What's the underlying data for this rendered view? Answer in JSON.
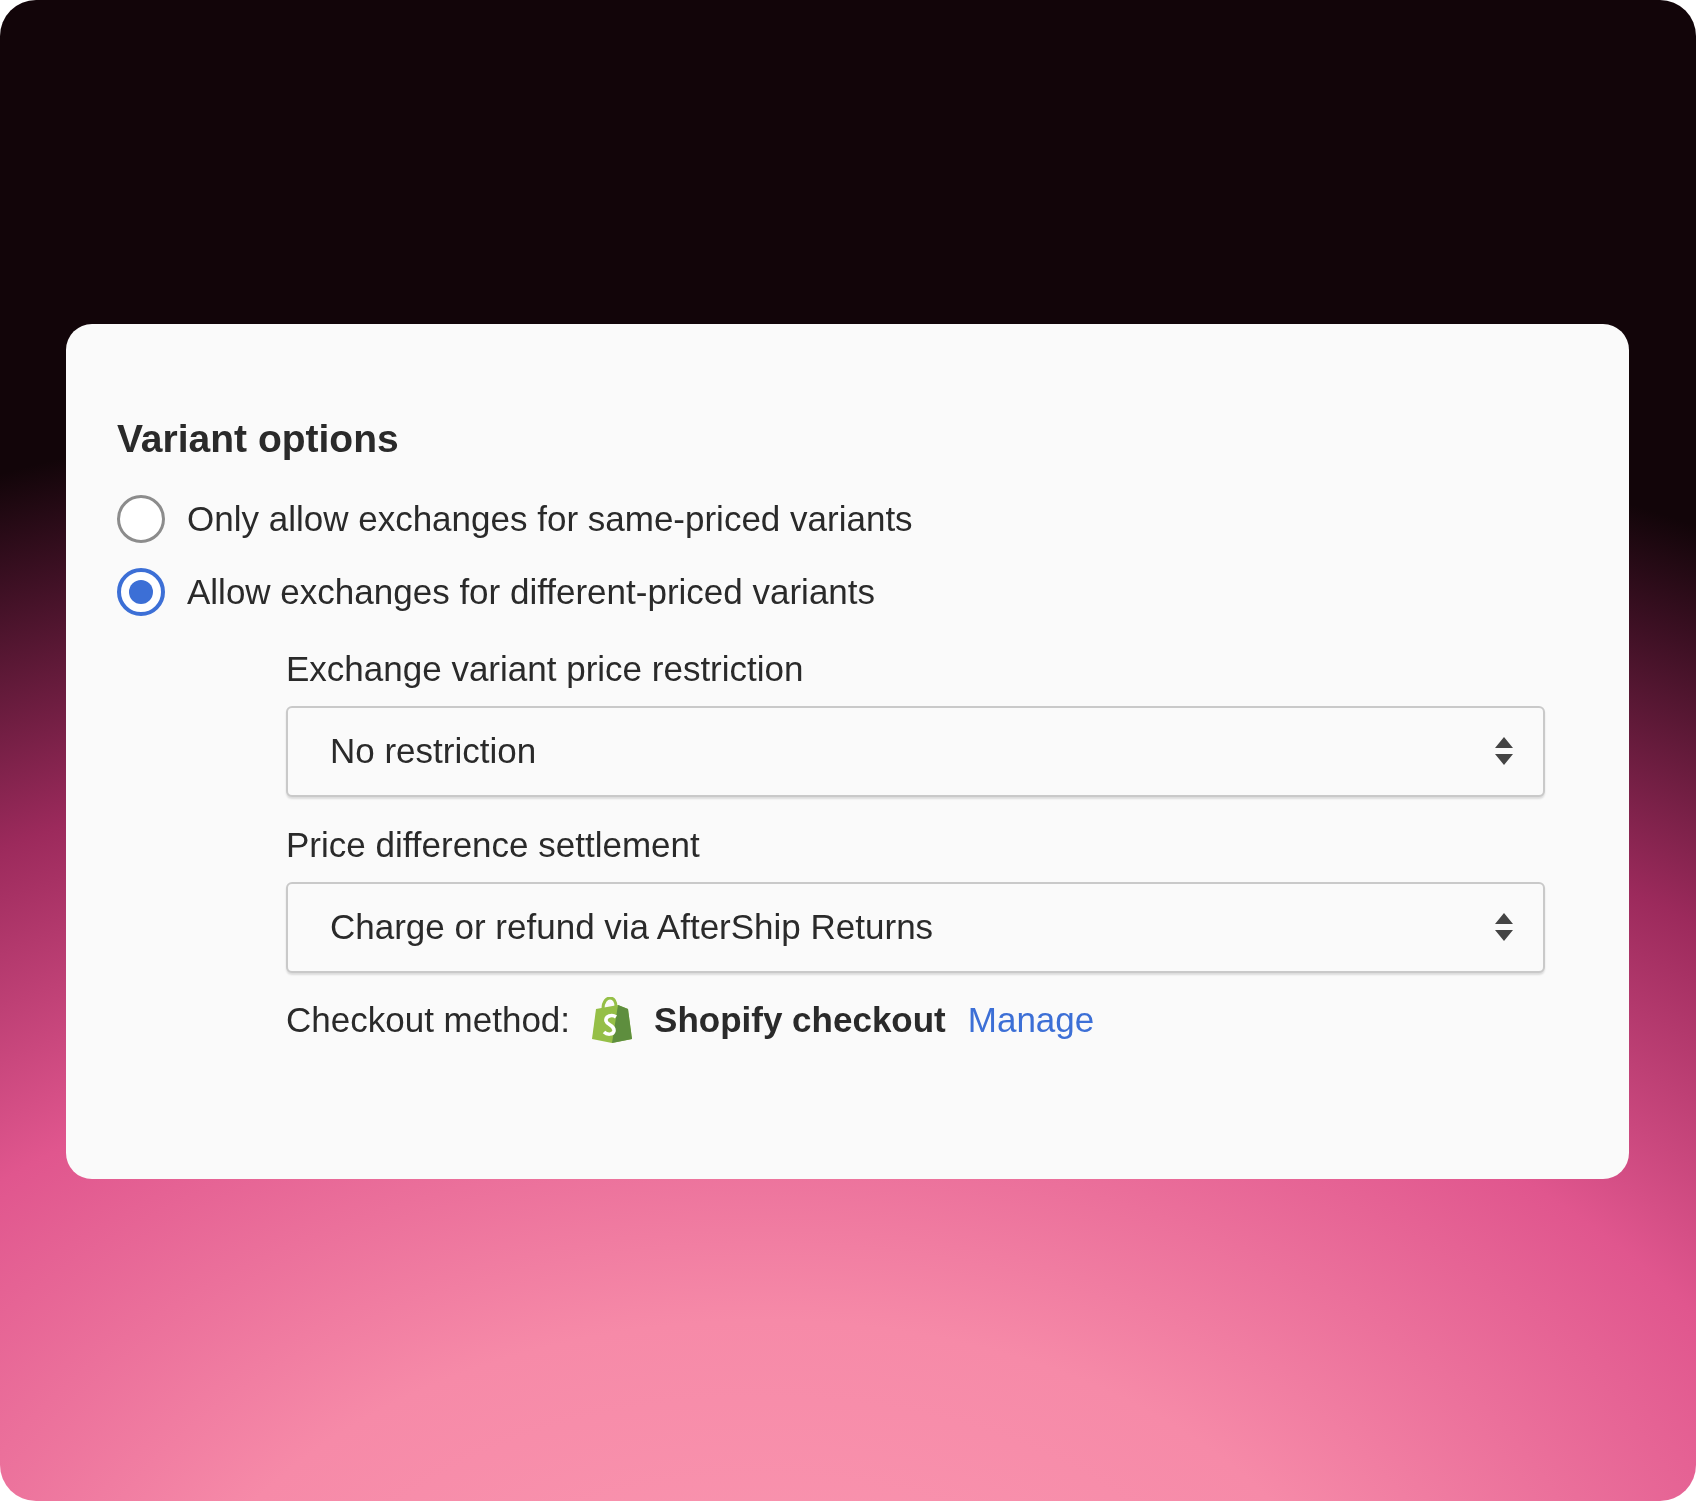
{
  "card": {
    "title": "Variant options",
    "options": [
      {
        "label": "Only allow exchanges for same-priced variants",
        "selected": false
      },
      {
        "label": "Allow exchanges for different-priced variants",
        "selected": true
      }
    ],
    "fields": [
      {
        "label": "Exchange variant price restriction",
        "value": "No restriction"
      },
      {
        "label": "Price difference settlement",
        "value": "Charge or refund via AfterShip Returns"
      }
    ],
    "checkout": {
      "label": "Checkout method:",
      "method": "Shopify checkout",
      "link": "Manage"
    }
  }
}
